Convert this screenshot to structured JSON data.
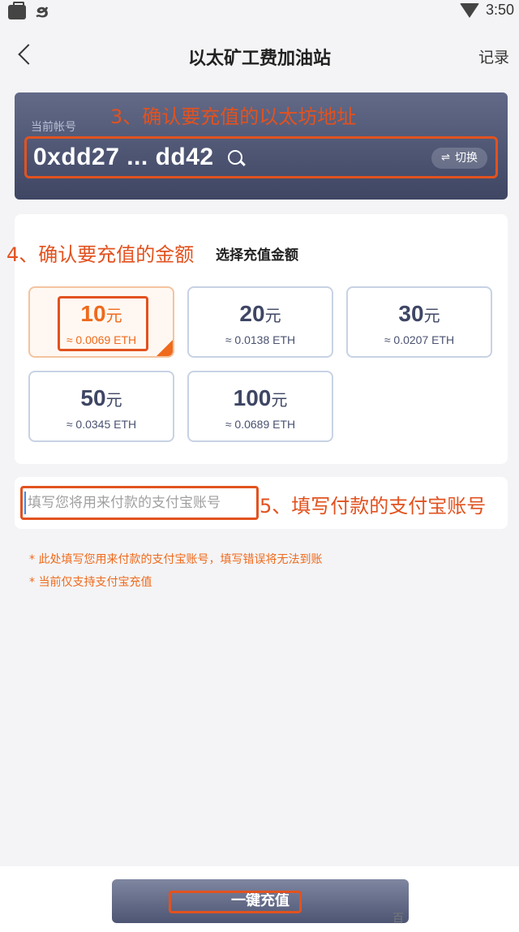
{
  "status_bar": {
    "app_glyph": "ϧ",
    "time": "3:50"
  },
  "header": {
    "title": "以太矿工费加油站",
    "records_label": "记录"
  },
  "account": {
    "label": "当前帐号",
    "address": "0xdd27 ... dd42",
    "switch_label": "切换"
  },
  "amount": {
    "title": "选择充值金额",
    "unit": "元",
    "options": [
      {
        "value": "10",
        "eth": "≈ 0.0069 ETH",
        "selected": true
      },
      {
        "value": "20",
        "eth": "≈ 0.0138 ETH",
        "selected": false
      },
      {
        "value": "30",
        "eth": "≈ 0.0207 ETH",
        "selected": false
      },
      {
        "value": "50",
        "eth": "≈ 0.0345 ETH",
        "selected": false
      },
      {
        "value": "100",
        "eth": "≈ 0.0689 ETH",
        "selected": false
      }
    ]
  },
  "alipay": {
    "placeholder": "填写您将用来付款的支付宝账号"
  },
  "notes": [
    "* 此处填写您用来付款的支付宝账号，填写错误将无法到账",
    "* 当前仅支持支付宝充值"
  ],
  "annotations": {
    "step3": "3、确认要充值的以太坊地址",
    "step4": "4、确认要充值的金额",
    "step5": "5、填写付款的支付宝账号"
  },
  "submit_label": "一键充值",
  "watermark": "百",
  "colors": {
    "accent": "#ef6a1c",
    "annotation": "#e2521f",
    "card_dark": "#3e4664"
  }
}
